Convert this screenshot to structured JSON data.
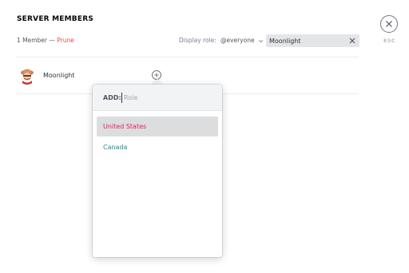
{
  "header": {
    "title": "SERVER MEMBERS",
    "member_count": "1 Member",
    "separator": "—",
    "prune_label": "Prune",
    "display_role_label": "Display role:",
    "display_role_value": "@everyone",
    "search_value": "Moonlight",
    "esc_label": "ESC"
  },
  "members": [
    {
      "name": "Moonlight"
    }
  ],
  "role_popout": {
    "add_label": "ADD:",
    "input_placeholder": "Role",
    "options": [
      {
        "label": "United States",
        "color": "#e91e63",
        "selected": true
      },
      {
        "label": "Canada",
        "color": "#1f8b9c",
        "selected": false
      }
    ]
  },
  "colors": {
    "prune": "#f04747",
    "search_bg": "#e3e5e8"
  },
  "icons": {
    "close": "close-icon",
    "clear": "clear-icon",
    "chevron": "chevron-down-icon",
    "add": "plus-icon"
  }
}
